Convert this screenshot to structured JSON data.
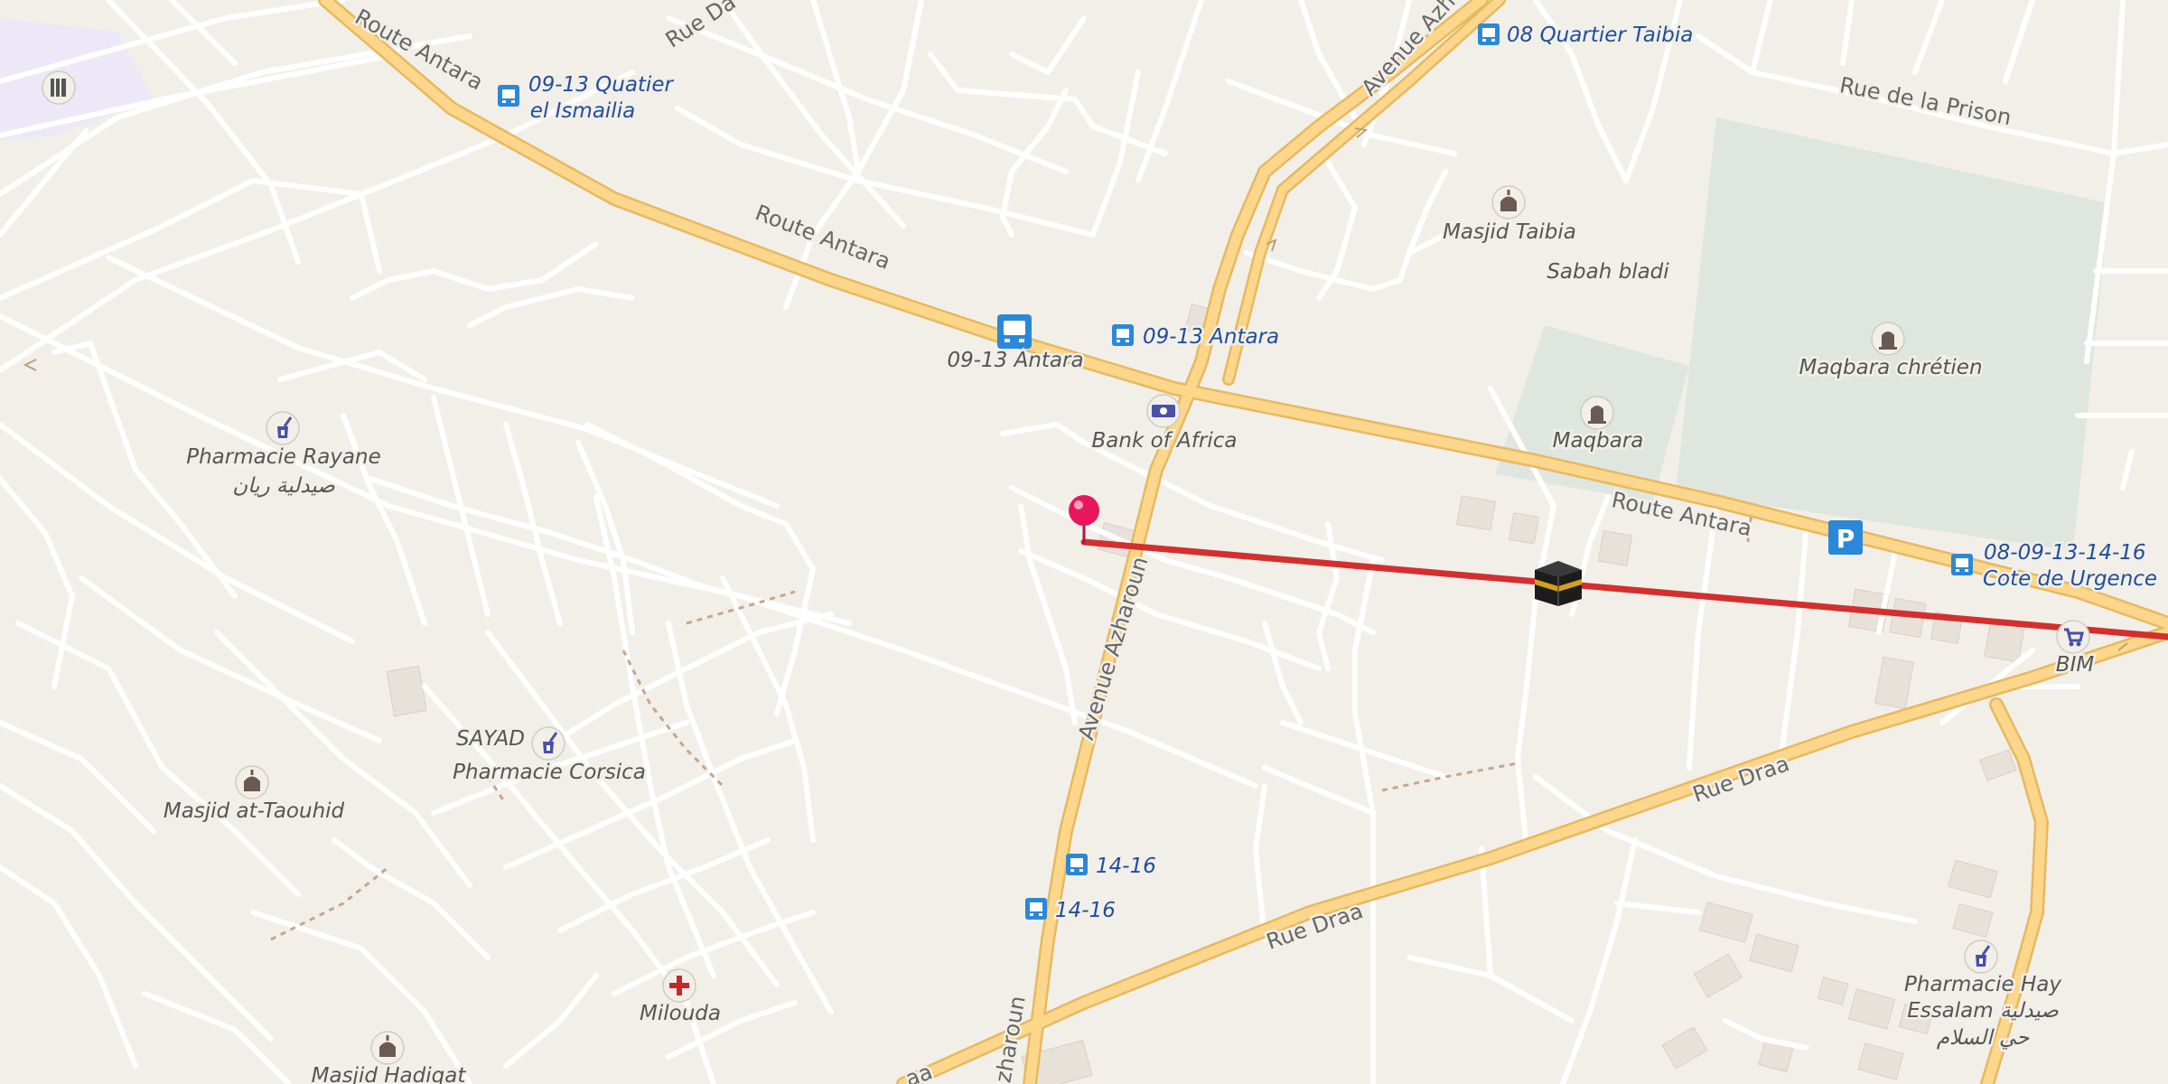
{
  "map": {
    "streets": {
      "route_antara_1": "Route Antara",
      "route_antara_2": "Route Antara",
      "route_antara_3": "Route Antara",
      "avenue_azharoun_1": "Avenue Azharoun",
      "avenue_azharoun_2": "Azharoun",
      "avenue_azharoun_top": "Avenue Azh",
      "rue_draa_1": "Rue Draa",
      "rue_draa_2": "Rue Draa",
      "rue_draa_3": "aa",
      "rue_de_la_prison": "Rue de la Prison",
      "rue_da": "Rue Da"
    },
    "bus_stops": {
      "quatier_ismailia_1": "09-13 Quatier",
      "quatier_ismailia_2": "el Ismailia",
      "quartier_taibia": "08 Quartier Taibia",
      "antara_east": "09-13 Antara",
      "antara_station": "09-13 Antara",
      "cote_urgence_1": "08-09-13-14-16",
      "cote_urgence_2": "Cote de Urgence",
      "stop_14_16_a": "14-16",
      "stop_14_16_b": "14-16"
    },
    "pois": {
      "masjid_taibia": "Masjid Taibia",
      "sabah_bladi": "Sabah bladi",
      "maqbara_chretien": "Maqbara chrétien",
      "maqbara": "Maqbara",
      "bank_of_africa": "Bank of Africa",
      "pharmacie_rayane_1": "Pharmacie Rayane",
      "pharmacie_rayane_2": "صيدلية ريان",
      "sayad": "SAYAD",
      "pharmacie_corsica": "Pharmacie Corsica",
      "masjid_at_taouhid": "Masjid at-Taouhid",
      "milouda": "Milouda",
      "masjid_hadiqat": "Masjid Hadiqat",
      "bim": "BIM",
      "pharmacie_essalam_1": "Pharmacie Hay",
      "pharmacie_essalam_2": "Essalam صيدلية",
      "pharmacie_essalam_3": "حي السلام",
      "parking": "P"
    },
    "colors": {
      "background": "#f2efe9",
      "road_major": "#fcd68a",
      "road_casing": "#e6b960",
      "road_minor": "#ffffff",
      "cemetery": "#dfe6df",
      "qibla_line": "#d32f2f",
      "pin": "#e8175d",
      "bus_icon": "#2b88d8",
      "parking_icon": "#2b88d8"
    },
    "icons": {
      "pin": "map-pin-icon",
      "kaaba": "kaaba-icon",
      "bus": "bus-stop-icon",
      "mosque": "mosque-icon",
      "pharmacy": "pharmacy-icon",
      "cemetery": "cemetery-icon",
      "bank": "bank-icon",
      "doctor": "doctor-icon",
      "shop": "shop-icon",
      "parking": "parking-icon",
      "library": "library-icon"
    }
  }
}
